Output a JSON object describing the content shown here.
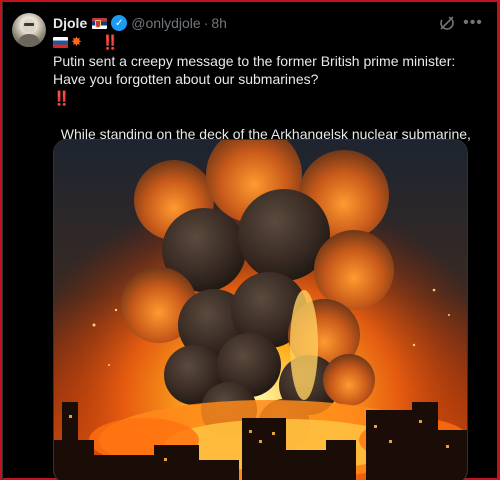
{
  "tweet": {
    "author_name": "Djole",
    "author_flag_icon": "serbia-flag-icon",
    "verified_icon": "verified-badge-icon",
    "handle": "@onlydjole",
    "separator": "·",
    "time": "8h",
    "line1_text": "Putin sent a creepy message to the former British prime minister: Have you forgotten about our submarines?",
    "exclaim": "‼️",
    "paragraph2": "While standing on the deck of the Arkhangelsk nuclear submarine, Russian President Vladimir Putin sent one of the most direct messages to Britain's political elite in a decade.",
    "point_emoji": "👇",
    "grok_icon": "grok-icon",
    "more_icon": "more-options-icon",
    "media_icon": "explosion-fire-image"
  },
  "colors": {
    "background": "#000000",
    "text": "#e7e9ea",
    "muted": "#71767b",
    "verified": "#1d9bf0",
    "frame_border": "#c4121a"
  }
}
